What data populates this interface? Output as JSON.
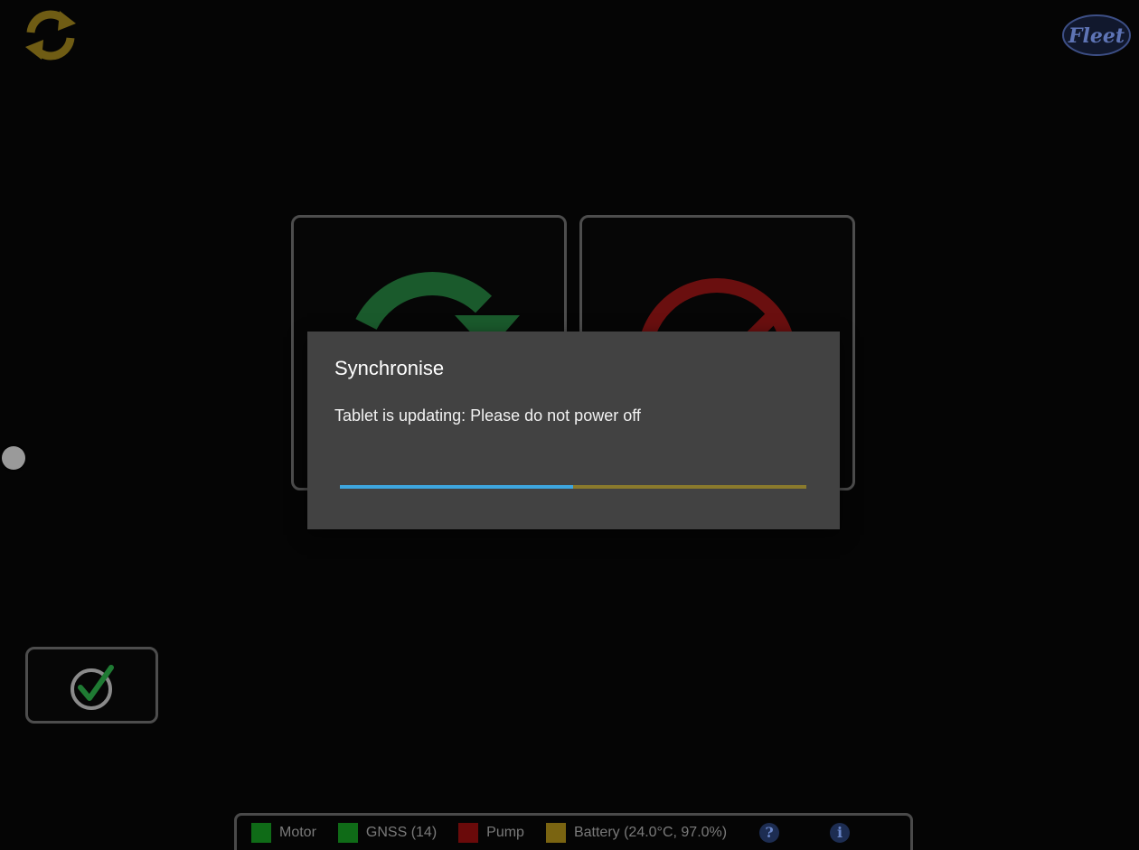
{
  "dialog": {
    "title": "Synchronise",
    "message": "Tablet is updating: Please do not power off",
    "progress": 0.5
  },
  "header": {
    "logo_text": "Fleet",
    "sync_icon": "sync-icon"
  },
  "tiles": [
    {
      "icon": "sync-arrow-icon",
      "color": "#1a5a2c"
    },
    {
      "icon": "cancel-icon",
      "color": "#6a0f0f"
    }
  ],
  "confirm_button": {
    "icon": "checkmark-icon",
    "color": "#1f7a33"
  },
  "status_bar": {
    "items": [
      {
        "label": "Motor",
        "color": "#0f6b17"
      },
      {
        "label": "GNSS (14)",
        "color": "#0f6b17"
      },
      {
        "label": "Pump",
        "color": "#6a0a0a"
      },
      {
        "label": "Battery (24.0°C, 97.0%)",
        "color": "#7a6411"
      }
    ],
    "help_symbol": "?",
    "info_symbol": "i"
  },
  "colors": {
    "accent": "#3ea6df",
    "progress_track": "#8a7a2c",
    "dialog_bg": "#424242",
    "sync_gold": "#6f5c14"
  }
}
